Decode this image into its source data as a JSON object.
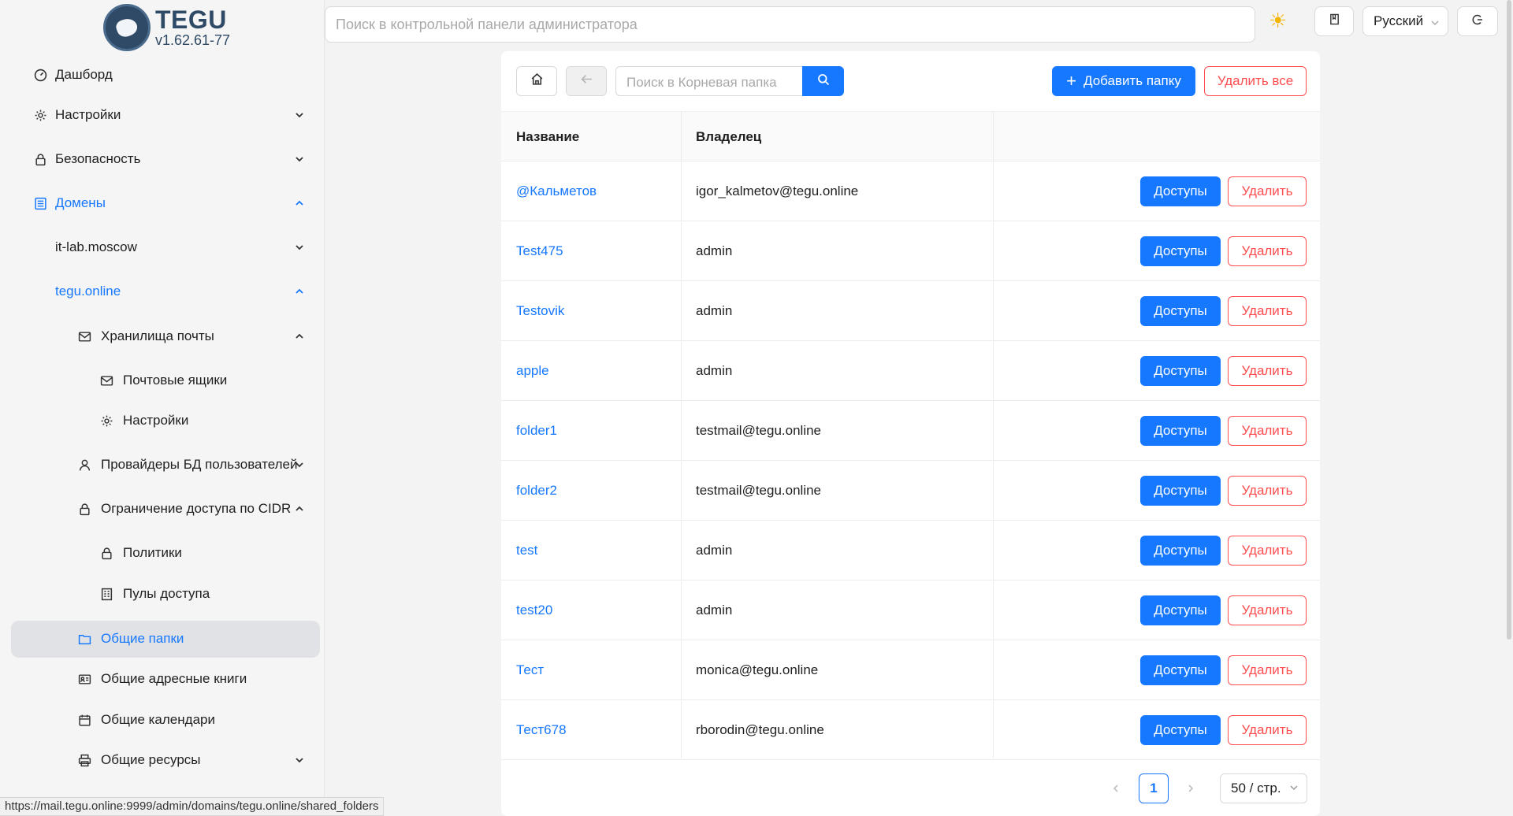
{
  "brand": {
    "title": "TEGU",
    "version": "v1.62.61-77"
  },
  "global_search": {
    "placeholder": "Поиск в контрольной панели администратора"
  },
  "header": {
    "language": "Русский"
  },
  "sidebar": {
    "items": [
      {
        "label": "Дашборд",
        "icon": "dashboard-icon"
      },
      {
        "label": "Настройки",
        "icon": "gear-icon"
      },
      {
        "label": "Безопасность",
        "icon": "lock-icon"
      },
      {
        "label": "Домены",
        "icon": "domains-icon"
      },
      {
        "label": "it-lab.moscow"
      },
      {
        "label": "tegu.online"
      },
      {
        "label": "Хранилища почты",
        "icon": "mail-icon"
      },
      {
        "label": "Почтовые ящики",
        "icon": "mail-icon"
      },
      {
        "label": "Настройки",
        "icon": "gear-icon"
      },
      {
        "label": "Провайдеры БД пользователей",
        "icon": "user-icon"
      },
      {
        "label": "Ограничение доступа по CIDR",
        "icon": "lock-icon"
      },
      {
        "label": "Политики",
        "icon": "lock-icon"
      },
      {
        "label": "Пулы доступа",
        "icon": "building-icon"
      },
      {
        "label": "Общие папки",
        "icon": "folder-icon"
      },
      {
        "label": "Общие адресные книги",
        "icon": "contact-card-icon"
      },
      {
        "label": "Общие календари",
        "icon": "calendar-icon"
      },
      {
        "label": "Общие ресурсы",
        "icon": "printer-icon"
      }
    ]
  },
  "status_url": "https://mail.tegu.online:9999/admin/domains/tegu.online/shared_folders",
  "toolbar": {
    "folder_search_placeholder": "Поиск в Корневая папка",
    "add_label": "Добавить папку",
    "delete_all_label": "Удалить все"
  },
  "table": {
    "headers": {
      "name": "Название",
      "owner": "Владелец"
    },
    "rows": [
      {
        "name": "@Кальметов",
        "owner": "igor_kalmetov@tegu.online"
      },
      {
        "name": "Test475",
        "owner": "admin"
      },
      {
        "name": "Testovik",
        "owner": "admin"
      },
      {
        "name": "apple",
        "owner": "admin"
      },
      {
        "name": "folder1",
        "owner": "testmail@tegu.online"
      },
      {
        "name": "folder2",
        "owner": "testmail@tegu.online"
      },
      {
        "name": "test",
        "owner": "admin"
      },
      {
        "name": "test20",
        "owner": "admin"
      },
      {
        "name": "Тест",
        "owner": "monica@tegu.online"
      },
      {
        "name": "Тест678",
        "owner": "rborodin@tegu.online"
      }
    ],
    "access_label": "Доступы",
    "delete_label": "Удалить"
  },
  "pagination": {
    "current_page": "1",
    "page_size": "50 / стр."
  },
  "colors": {
    "accent": "#1677ff",
    "danger": "#ff4d4f",
    "brand": "#2f4a66"
  }
}
